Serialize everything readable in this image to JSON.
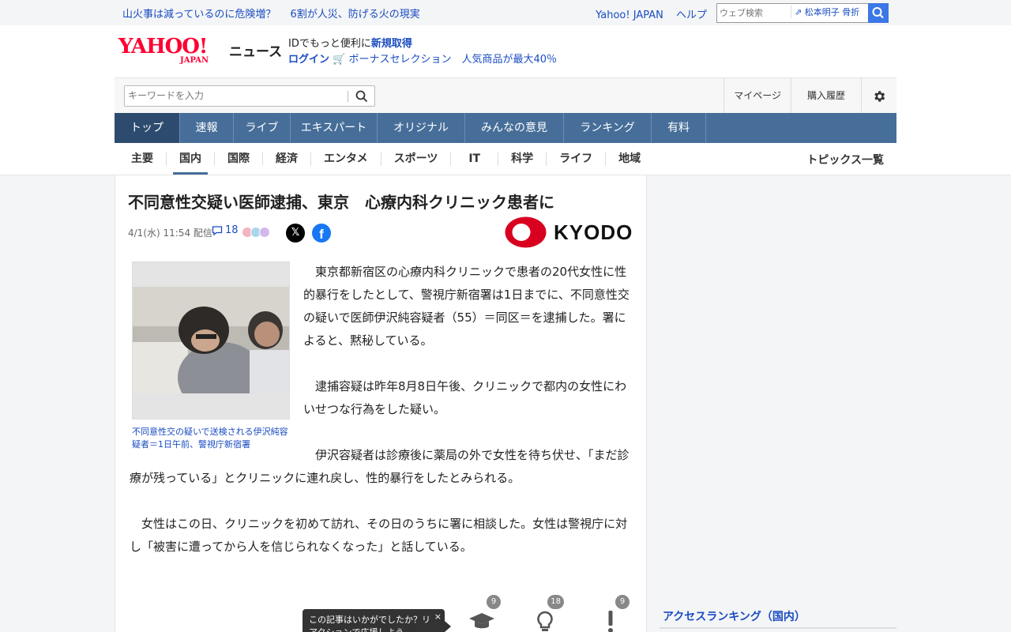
{
  "topbar": {
    "links": [
      "山火事は減っているのに危険増？",
      "6割が人災、防げる火の現実"
    ],
    "right_links": [
      "Yahoo! JAPAN",
      "ヘルプ"
    ],
    "web_search_placeholder": "ウェブ検索",
    "suggest": "松本明子 骨折"
  },
  "header": {
    "logo_yahoo": "YAHOO!",
    "logo_japan": "JAPAN",
    "logo_news": "ニュース",
    "promo_line1_prefix": "IDでもっと便利に",
    "promo_line1_link": "新規取得",
    "promo_login": "ログイン",
    "promo_line2": "ボーナスセレクション　人気商品が最大40％"
  },
  "search": {
    "placeholder": "キーワードを入力",
    "mypage": "マイページ",
    "history": "購入履歴"
  },
  "nav": {
    "items": [
      "トップ",
      "速報",
      "ライブ",
      "エキスパート",
      "オリジナル",
      "みんなの意見",
      "ランキング",
      "有料"
    ]
  },
  "subnav": {
    "items": [
      "主要",
      "国内",
      "国際",
      "経済",
      "エンタメ",
      "スポーツ",
      "IT",
      "科学",
      "ライフ",
      "地域"
    ],
    "active": "国内",
    "all_topics": "トピックス一覧"
  },
  "article": {
    "title": "不同意性交疑い医師逮捕、東京　心療内科クリニック患者に",
    "date": "4/1(水) 11:54 配信",
    "comment_count": "18",
    "source": "KYODO",
    "photo_caption": "不同意性交の疑いで送検される伊沢純容疑者＝1日午前、警視庁新宿署",
    "paragraphs": [
      "東京都新宿区の心療内科クリニックで患者の20代女性に性的暴行をしたとして、警視庁新宿署は1日までに、不同意性交の疑いで医師伊沢純容疑者（55）＝同区＝を逮捕した。署によると、黙秘している。",
      "逮捕容疑は昨年8月8日午後、クリニックで都内の女性にわいせつな行為をした疑い。",
      "伊沢容疑者は診療後に薬局の外で女性を待ち伏せ、「まだ診療が残っている」とクリニックに連れ戻し、性的暴行をしたとみられる。",
      "女性はこの日、クリニックを初めて訪れ、その日のうちに署に相談した。女性は警視庁に対し「被害に遭ってから人を信じられなくなった」と話している。"
    ]
  },
  "reactions": {
    "tooltip": "この記事はいかがでしたか？リアクションで応援しよう",
    "tooltip_close": "×",
    "learn_count": "9",
    "idea_count": "18",
    "exclaim_count": "9"
  },
  "sidebar": {
    "ranking_title": "アクセスランキング（国内）"
  },
  "colors": {
    "nav_bg": "#466e99",
    "link": "#1a4cc2",
    "brand_red": "#ff0033"
  }
}
